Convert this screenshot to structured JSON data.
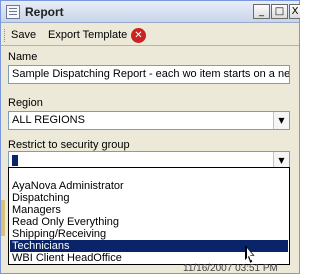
{
  "window": {
    "title": "Report"
  },
  "title_buttons": {
    "minimize": "_",
    "maximize": "□",
    "close": "X"
  },
  "toolbar": {
    "save_label": "Save",
    "export_label": "Export Template",
    "close_glyph": "✕"
  },
  "form": {
    "name_label": "Name",
    "name_value": "Sample Dispatching Report - each wo item starts on a new page",
    "region_label": "Region",
    "region_value": "ALL REGIONS",
    "security_label": "Restrict to security group"
  },
  "combo_arrow": "▼",
  "security_options": [
    "",
    "AyaNova Administrator",
    "Dispatching",
    "Managers",
    "Read Only Everything",
    "Shipping/Receiving",
    "Technicians",
    "WBI Client HeadOffice"
  ],
  "selected_option_index": 6,
  "background": {
    "date_text": "11/16/2007 03:51 PM"
  },
  "colors": {
    "selection": "#0a246a",
    "close_icon": "#cc2222",
    "window_bg": "#ece9d8"
  }
}
